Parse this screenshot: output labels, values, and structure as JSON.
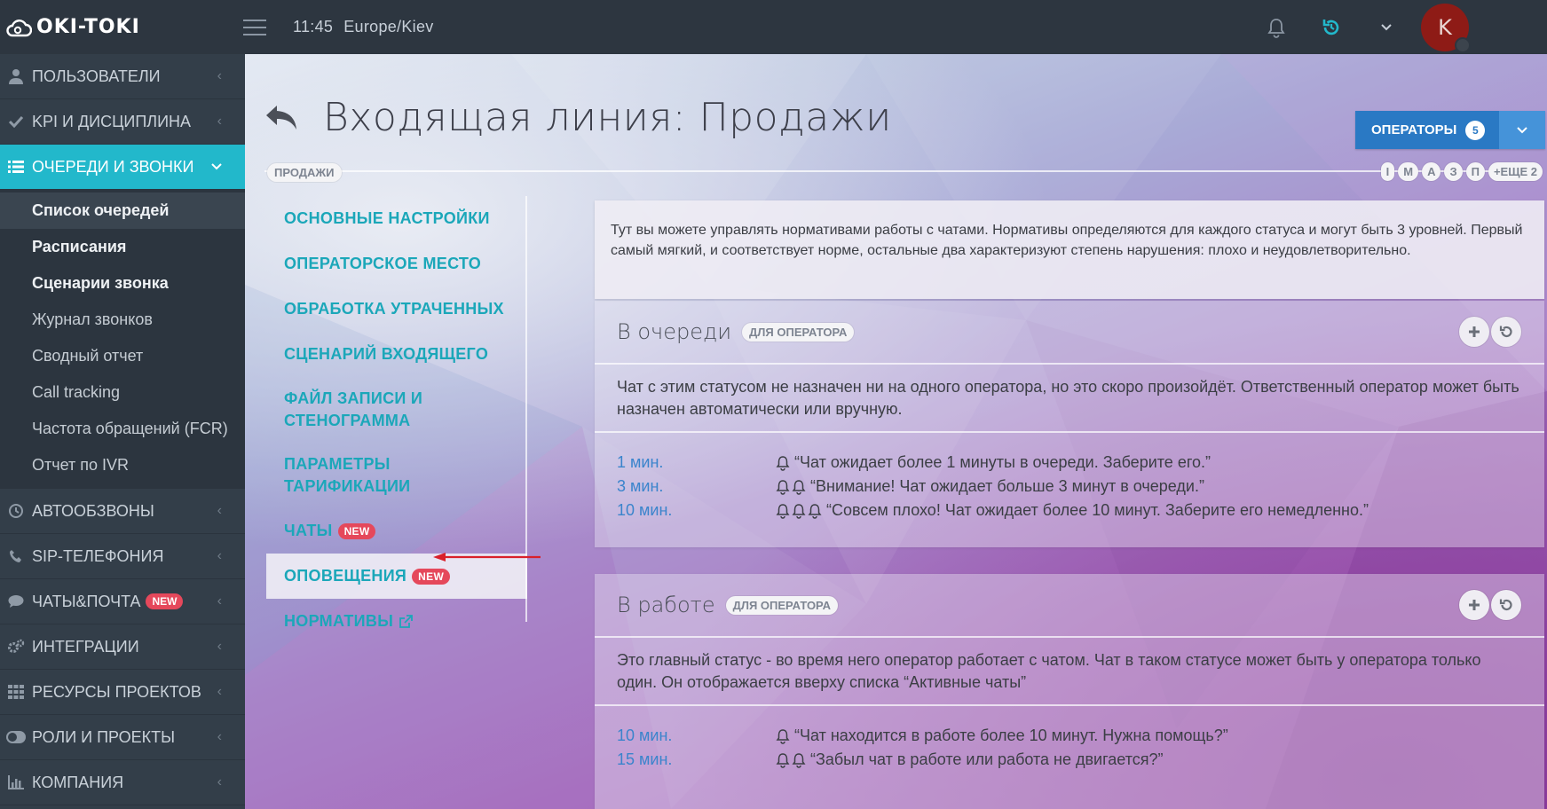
{
  "app": {
    "logo_text": "OKI-TOKI"
  },
  "topbar": {
    "time": "11:45",
    "timezone": "Europe/Kiev",
    "avatar_letter": "K"
  },
  "sidebar": {
    "items": [
      {
        "label": "ПОЛЬЗОВАТЕЛИ",
        "icon": "user-icon"
      },
      {
        "label": "KPI И ДИСЦИПЛИНА",
        "icon": "check-icon"
      },
      {
        "label": "ОЧЕРЕДИ И ЗВОНКИ",
        "icon": "list-icon"
      },
      {
        "label": "АВТООБЗВОНЫ",
        "icon": "clock-icon"
      },
      {
        "label": "SIP-ТЕЛЕФОНИЯ",
        "icon": "phone-icon"
      },
      {
        "label": "ЧАТЫ&ПОЧТА",
        "icon": "chat-icon",
        "badge": "NEW"
      },
      {
        "label": "ИНТЕГРАЦИИ",
        "icon": "cogs-icon"
      },
      {
        "label": "РЕСУРСЫ ПРОЕКТОВ",
        "icon": "grid-icon"
      },
      {
        "label": "РОЛИ И ПРОЕКТЫ",
        "icon": "toggle-icon"
      },
      {
        "label": "КОМПАНИЯ",
        "icon": "bar-chart-icon"
      }
    ],
    "sub_items": [
      "Список очередей",
      "Расписания",
      "Сценарии звонка",
      "Журнал звонков",
      "Сводный отчет",
      "Call tracking",
      "Частота обращений (FCR)",
      "Отчет по IVR"
    ]
  },
  "page": {
    "title": "Входящая линия: Продажи",
    "breadcrumb": "ПРОДАЖИ",
    "operators_button": "ОПЕРАТОРЫ",
    "operators_count": "5",
    "queue_pills": [
      "I",
      "M",
      "A",
      "З",
      "П",
      "+ЕЩЕ 2"
    ]
  },
  "subnav": [
    {
      "label": "ОСНОВНЫЕ НАСТРОЙКИ"
    },
    {
      "label": "ОПЕРАТОРСКОЕ МЕСТО"
    },
    {
      "label": "ОБРАБОТКА УТРАЧЕННЫХ"
    },
    {
      "label": "СЦЕНАРИЙ ВХОДЯЩЕГО"
    },
    {
      "label": "ФАЙЛ ЗАПИСИ И СТЕНОГРАММА"
    },
    {
      "label": "ПАРАМЕТРЫ ТАРИФИКАЦИИ"
    },
    {
      "label": "ЧАТЫ",
      "badge": "NEW"
    },
    {
      "label": "ОПОВЕЩЕНИЯ",
      "badge": "NEW"
    },
    {
      "label": "НОРМАТИВЫ"
    }
  ],
  "info_text": "Тут вы можете управлять нормативами работы с чатами. Нормативы определяются для каждого статуса и могут быть 3 уровней. Первый самый мягкий, и соответствует норме, остальные два характеризуют степень нарушения: плохо и неудовлетворительно.",
  "cards": [
    {
      "title": "В очереди",
      "tag": "ДЛЯ ОПЕРАТОРА",
      "description": "Чат с этим статусом не назначен ни на одного оператора, но это скоро произойдёт. Ответственный оператор может быть назначен автоматически или вручную.",
      "rules": [
        {
          "time": "1 мин.",
          "text": "“Чат ожидает более 1 минуты в очереди. Заберите его.”"
        },
        {
          "time": "3 мин.",
          "text": "“Внимание! Чат ожидает больше 3 минут в очереди.”"
        },
        {
          "time": "10 мин.",
          "text": "“Совсем плохо! Чат ожидает более 10 минут. Заберите его немедленно.”"
        }
      ]
    },
    {
      "title": "В работе",
      "tag": "ДЛЯ ОПЕРАТОРА",
      "description": "Это главный статус - во время него оператор работает с чатом. Чат в таком статусе может быть у оператора только один. Он отображается вверху списка “Активные чаты”",
      "rules": [
        {
          "time": "10 мин.",
          "text": "“Чат находится в работе более 10 минут. Нужна помощь?”"
        },
        {
          "time": "15 мин.",
          "text": "“Забыл чат в работе или работа не двигается?”"
        }
      ]
    }
  ],
  "colors": {
    "accent": "#22b8cb",
    "link": "#1ba7b9",
    "badge": "#e5485b",
    "primary": "#2a79c4",
    "arrow": "#d9202a"
  }
}
